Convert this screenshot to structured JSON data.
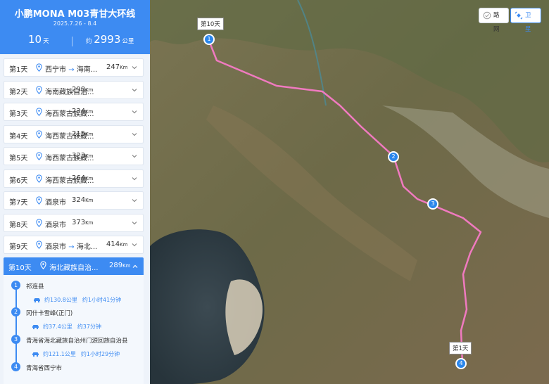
{
  "header": {
    "title": "小鹏MONA M03青甘大环线",
    "dates": "2025.7.26 - 8.4",
    "days_value": "10",
    "days_unit": "天",
    "km_prefix": "约",
    "km_value": "2993",
    "km_unit": "公里"
  },
  "days": [
    {
      "label": "第1天",
      "from": "西宁市",
      "to": "海南...",
      "dist": "247",
      "unit": "Km"
    },
    {
      "label": "第2天",
      "from": "海南藏族自治...",
      "to": "",
      "dist": "298",
      "unit": "Km"
    },
    {
      "label": "第3天",
      "from": "海西蒙古族藏...",
      "to": "",
      "dist": "234",
      "unit": "Km"
    },
    {
      "label": "第4天",
      "from": "海西蒙古族藏...",
      "to": "",
      "dist": "215",
      "unit": "Km"
    },
    {
      "label": "第5天",
      "from": "海西蒙古族藏...",
      "to": "",
      "dist": "323",
      "unit": "Km"
    },
    {
      "label": "第6天",
      "from": "海西蒙古族藏...",
      "to": "",
      "dist": "264",
      "unit": "Km"
    },
    {
      "label": "第7天",
      "from": "酒泉市",
      "to": "",
      "dist": "324",
      "unit": "Km"
    },
    {
      "label": "第8天",
      "from": "酒泉市",
      "to": "",
      "dist": "373",
      "unit": "Km"
    },
    {
      "label": "第9天",
      "from": "酒泉市",
      "to": "海北...",
      "dist": "414",
      "unit": "Km"
    }
  ],
  "arrow": "→",
  "active_day": {
    "label": "第10天",
    "place": "海北藏族自治...",
    "dist": "289",
    "unit": "Km"
  },
  "stops": [
    {
      "num": "1",
      "name": "祁连县"
    },
    {
      "num": "2",
      "name": "冈什卡雪峰(正门)"
    },
    {
      "num": "3",
      "name": "青海省海北藏族自治州门源回族自治县"
    },
    {
      "num": "4",
      "name": "青海省西宁市"
    }
  ],
  "legs": [
    {
      "distance": "约130.8公里",
      "duration": "约1小时41分钟"
    },
    {
      "distance": "约37.4公里",
      "duration": "约37分钟"
    },
    {
      "distance": "约121.1公里",
      "duration": "约1小时29分钟"
    }
  ],
  "map": {
    "road_button": "路网",
    "satellite_button": "卫星",
    "start_callout": "第1天",
    "end_callout": "第10天",
    "markers": [
      "1",
      "2",
      "3",
      "4"
    ],
    "route_color": "#f07ac0",
    "accent": "#3d8bf2"
  },
  "icons": [
    "location-pin-icon",
    "chevron-down-icon",
    "chevron-up-icon",
    "car-icon",
    "road-network-icon",
    "satellite-icon"
  ]
}
